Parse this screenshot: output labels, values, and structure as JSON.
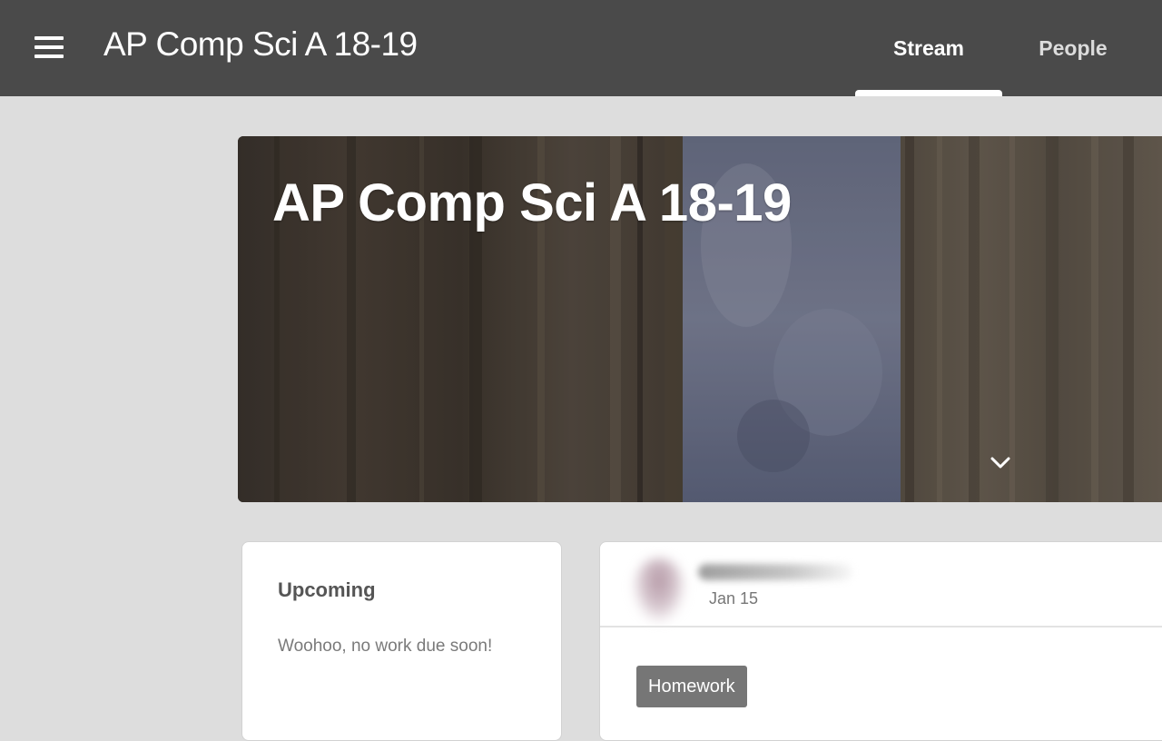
{
  "header": {
    "menu_icon": "hamburger-menu-icon",
    "title": "AP Comp Sci A 18-19",
    "tabs": [
      {
        "label": "Stream",
        "active": true
      },
      {
        "label": "People",
        "active": false
      }
    ]
  },
  "banner": {
    "title": "AP Comp Sci A 18-19",
    "expand_icon": "chevron-down-icon"
  },
  "upcoming": {
    "title": "Upcoming",
    "empty_message": "Woohoo, no work due soon!"
  },
  "post": {
    "date": "Jan 15",
    "topic": "Homework"
  },
  "colors": {
    "app_bar": "#4a4a4a",
    "page_background": "#dddddd",
    "chip_background": "#767676"
  }
}
